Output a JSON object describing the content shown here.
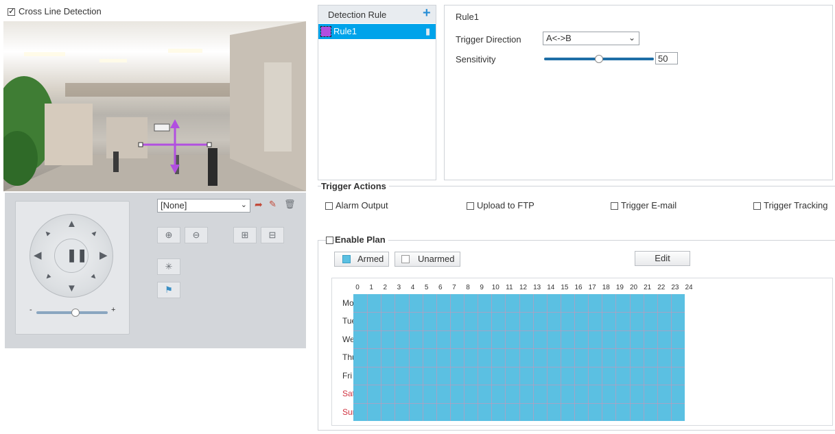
{
  "detection_toggle": {
    "label": "Cross Line Detection",
    "checked": true
  },
  "ptz": {
    "preset_select": "[None]",
    "icons": [
      "up-icon",
      "down-icon",
      "left-icon",
      "right-icon",
      "up-left-icon",
      "up-right-icon",
      "down-left-icon",
      "down-right-icon",
      "pause-icon",
      "zoom-in-icon",
      "zoom-out-icon",
      "focus-near-icon",
      "focus-far-icon",
      "wiper-icon",
      "light-icon",
      "go-to-preset-icon",
      "edit-preset-icon",
      "delete-preset-icon"
    ],
    "speed_minus": "-",
    "speed_plus": "+",
    "speed_level": 0.55
  },
  "rules": {
    "header": "Detection Rule",
    "items": [
      {
        "label": "Rule1",
        "color": "#b14fe0",
        "selected": true
      }
    ]
  },
  "rule_detail": {
    "title": "Rule1",
    "trigger_direction_label": "Trigger Direction",
    "trigger_direction_value": "A<->B",
    "sensitivity_label": "Sensitivity",
    "sensitivity_value": "50",
    "sensitivity_level": 0.5
  },
  "trigger_actions": {
    "title": "Trigger Actions",
    "options": [
      {
        "label": "Alarm Output",
        "checked": false
      },
      {
        "label": "Upload to FTP",
        "checked": false
      },
      {
        "label": "Trigger E-mail",
        "checked": false
      },
      {
        "label": "Trigger Tracking",
        "checked": false
      }
    ]
  },
  "plan": {
    "enable_label": "Enable Plan",
    "enabled": false,
    "armed_label": "Armed",
    "unarmed_label": "Unarmed",
    "edit_label": "Edit",
    "armed_color": "#5bc0e2",
    "hours": [
      "0",
      "1",
      "2",
      "3",
      "4",
      "5",
      "6",
      "7",
      "8",
      "9",
      "10",
      "11",
      "12",
      "13",
      "14",
      "15",
      "16",
      "17",
      "18",
      "19",
      "20",
      "21",
      "22",
      "23",
      "24"
    ],
    "days": [
      "Mon",
      "Tue",
      "Wed",
      "Thu",
      "Fri",
      "Sat",
      "Sun"
    ],
    "weekend_color": "#d0313f"
  }
}
